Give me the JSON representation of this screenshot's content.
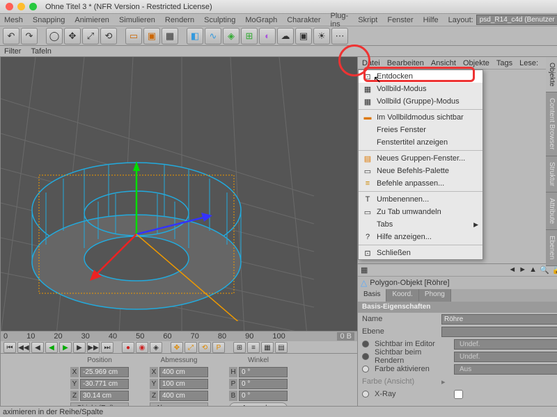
{
  "window": {
    "title": "Ohne Titel 3 * (NFR Version - Restricted License)"
  },
  "menubar": [
    "Mesh",
    "Snapping",
    "Animieren",
    "Simulieren",
    "Rendern",
    "Sculpting",
    "MoGraph",
    "Charakter",
    "Plug-ins",
    "Skript",
    "Fenster",
    "Hilfe"
  ],
  "layout": {
    "label": "Layout:",
    "value": "psd_R14_c4d (Benutzer)"
  },
  "subbar": [
    "Filter",
    "Tafeln"
  ],
  "panel_menus": [
    "Datei",
    "Bearbeiten",
    "Ansicht",
    "Objekte",
    "Tags",
    "Lese:"
  ],
  "context_menu": [
    {
      "icon": "⊡",
      "label": "Entdocken",
      "hl": true
    },
    {
      "icon": "▦",
      "label": "Vollbild-Modus"
    },
    {
      "icon": "▦",
      "label": "Vollbild (Gruppe)-Modus"
    },
    {
      "sep": true
    },
    {
      "icon": "▬",
      "label": "Im Vollbildmodus sichtbar",
      "iconcolor": "#d70"
    },
    {
      "icon": "",
      "label": "Freies Fenster"
    },
    {
      "icon": "",
      "label": "Fenstertitel anzeigen",
      "disabled": true
    },
    {
      "sep": true
    },
    {
      "icon": "▤",
      "label": "Neues Gruppen-Fenster...",
      "iconcolor": "#d70"
    },
    {
      "icon": "▭",
      "label": "Neue Befehls-Palette"
    },
    {
      "icon": "≡",
      "label": "Befehle anpassen...",
      "iconcolor": "#c80"
    },
    {
      "sep": true
    },
    {
      "icon": "T",
      "label": "Umbenennen..."
    },
    {
      "icon": "▭",
      "label": "Zu Tab umwandeln",
      "disabled": true
    },
    {
      "icon": "",
      "label": "Tabs",
      "arrow": true
    },
    {
      "icon": "?",
      "label": "Hilfe anzeigen..."
    },
    {
      "sep": true
    },
    {
      "icon": "⊡",
      "label": "Schließen"
    }
  ],
  "ruler": [
    "0",
    "10",
    "20",
    "30",
    "40",
    "50",
    "60",
    "70",
    "80",
    "90",
    "100"
  ],
  "ruler_end": "0 B",
  "coords": {
    "headers": [
      "Position",
      "Abmessung",
      "Winkel"
    ],
    "rows": [
      {
        "l": "X",
        "pos": "-25.969 cm",
        "dim": "400 cm",
        "ang_l": "H",
        "ang": "0 °"
      },
      {
        "l": "Y",
        "pos": "-30.771 cm",
        "dim": "100 cm",
        "ang_l": "P",
        "ang": "0 °"
      },
      {
        "l": "Z",
        "pos": "30.14 cm",
        "dim": "400 cm",
        "ang_l": "B",
        "ang": "0 °"
      }
    ],
    "mode1": "Objekt (Rel)",
    "mode2": "Abmessung",
    "apply": "Anwenden"
  },
  "attr": {
    "objname": "Polygon-Objekt [Röhre]",
    "tabs": [
      "Basis",
      "Koord.",
      "Phong"
    ],
    "section": "Basis-Eigenschaften",
    "props": {
      "name_lbl": "Name",
      "name_val": "Röhre",
      "layer_lbl": "Ebene",
      "layer_val": "",
      "vis_ed_lbl": "Sichtbar im Editor",
      "vis_ed_val": "Undef.",
      "vis_rn_lbl": "Sichtbar beim Rendern",
      "vis_rn_val": "Undef.",
      "color_lbl": "Farbe aktivieren",
      "color_val": "Aus",
      "colview_lbl": "Farbe (Ansicht)",
      "xray_lbl": "X-Ray"
    }
  },
  "sidetabs": [
    "Objekte",
    "Content Browser",
    "Struktur",
    "Attribute",
    "Ebenen"
  ],
  "status": "aximieren in der Reihe/Spalte"
}
